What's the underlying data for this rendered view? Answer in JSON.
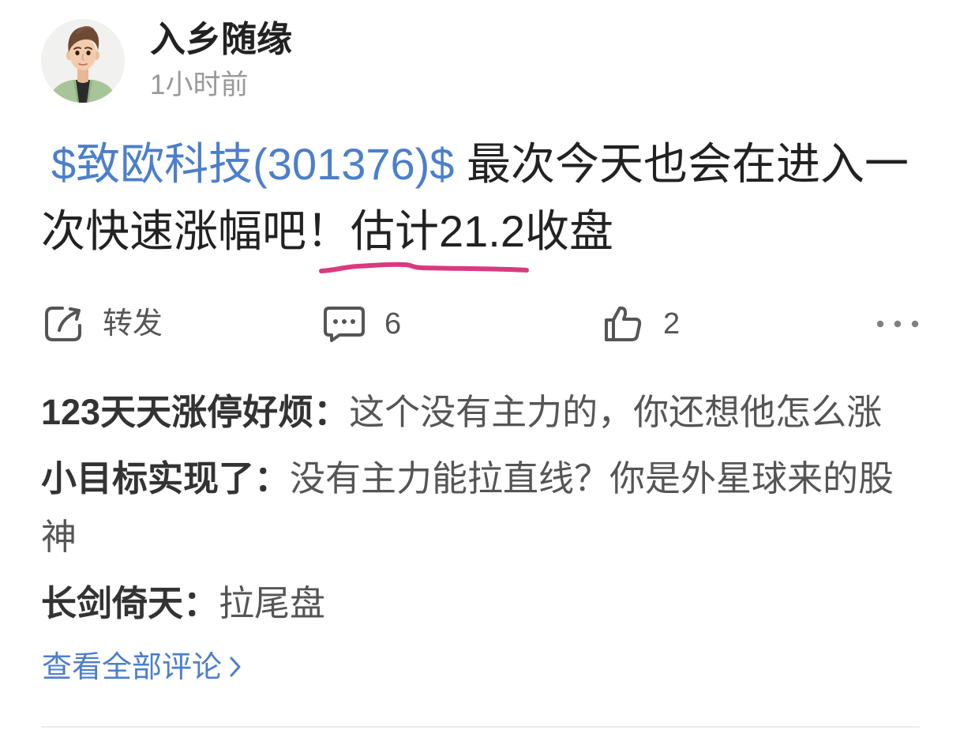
{
  "author": {
    "name": "入乡随缘",
    "time": "1小时前"
  },
  "post": {
    "mention": "$致欧科技(301376)$",
    "text": " 最次今天也会在进入一次快速涨幅吧！",
    "highlight": "估计21.2收盘"
  },
  "actions": {
    "repost_label": "转发",
    "comment_count": "6",
    "like_count": "2"
  },
  "comments": [
    {
      "author": "123天天涨停好烦：",
      "text": "这个没有主力的，你还想他怎么涨"
    },
    {
      "author": "小目标实现了：",
      "text": "没有主力能拉直线？你是外星球来的股神"
    },
    {
      "author": "长剑倚天：",
      "text": "拉尾盘"
    }
  ],
  "view_all_label": "查看全部评论",
  "icons": {
    "repost": "repost-icon",
    "comment": "comment-icon",
    "like": "thumbs-up-icon",
    "more": "more-dots-icon",
    "view_all": "chevron-right-icon"
  },
  "colors": {
    "link": "#4b7fcb",
    "text": "#222222",
    "muted": "#999999",
    "icon": "#555555",
    "annotation": "#d93a7f",
    "comment_author": "#333333",
    "comment_text": "#555555",
    "divider": "#ececec"
  }
}
